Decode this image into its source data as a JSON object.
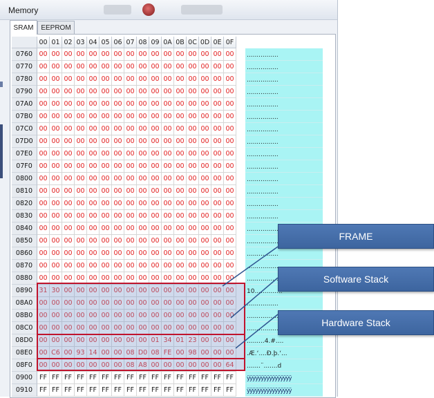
{
  "window": {
    "title": "Memory"
  },
  "tabs": [
    {
      "label": "SRAM",
      "active": true
    },
    {
      "label": "EEPROM",
      "active": false
    }
  ],
  "columns": [
    "00",
    "01",
    "02",
    "03",
    "04",
    "05",
    "06",
    "07",
    "08",
    "09",
    "0A",
    "0B",
    "0C",
    "0D",
    "0E",
    "0F"
  ],
  "rows": [
    {
      "addr": "0760",
      "bytes": [
        "00",
        "00",
        "00",
        "00",
        "00",
        "00",
        "00",
        "00",
        "00",
        "00",
        "00",
        "00",
        "00",
        "00",
        "00",
        "00"
      ],
      "ascii": "................"
    },
    {
      "addr": "0770",
      "bytes": [
        "00",
        "00",
        "00",
        "00",
        "00",
        "00",
        "00",
        "00",
        "00",
        "00",
        "00",
        "00",
        "00",
        "00",
        "00",
        "00"
      ],
      "ascii": "................"
    },
    {
      "addr": "0780",
      "bytes": [
        "00",
        "00",
        "00",
        "00",
        "00",
        "00",
        "00",
        "00",
        "00",
        "00",
        "00",
        "00",
        "00",
        "00",
        "00",
        "00"
      ],
      "ascii": "................"
    },
    {
      "addr": "0790",
      "bytes": [
        "00",
        "00",
        "00",
        "00",
        "00",
        "00",
        "00",
        "00",
        "00",
        "00",
        "00",
        "00",
        "00",
        "00",
        "00",
        "00"
      ],
      "ascii": "................"
    },
    {
      "addr": "07A0",
      "bytes": [
        "00",
        "00",
        "00",
        "00",
        "00",
        "00",
        "00",
        "00",
        "00",
        "00",
        "00",
        "00",
        "00",
        "00",
        "00",
        "00"
      ],
      "ascii": "................"
    },
    {
      "addr": "07B0",
      "bytes": [
        "00",
        "00",
        "00",
        "00",
        "00",
        "00",
        "00",
        "00",
        "00",
        "00",
        "00",
        "00",
        "00",
        "00",
        "00",
        "00"
      ],
      "ascii": "................"
    },
    {
      "addr": "07C0",
      "bytes": [
        "00",
        "00",
        "00",
        "00",
        "00",
        "00",
        "00",
        "00",
        "00",
        "00",
        "00",
        "00",
        "00",
        "00",
        "00",
        "00"
      ],
      "ascii": "................"
    },
    {
      "addr": "07D0",
      "bytes": [
        "00",
        "00",
        "00",
        "00",
        "00",
        "00",
        "00",
        "00",
        "00",
        "00",
        "00",
        "00",
        "00",
        "00",
        "00",
        "00"
      ],
      "ascii": "................"
    },
    {
      "addr": "07E0",
      "bytes": [
        "00",
        "00",
        "00",
        "00",
        "00",
        "00",
        "00",
        "00",
        "00",
        "00",
        "00",
        "00",
        "00",
        "00",
        "00",
        "00"
      ],
      "ascii": "................"
    },
    {
      "addr": "07F0",
      "bytes": [
        "00",
        "00",
        "00",
        "00",
        "00",
        "00",
        "00",
        "00",
        "00",
        "00",
        "00",
        "00",
        "00",
        "00",
        "00",
        "00"
      ],
      "ascii": "................"
    },
    {
      "addr": "0800",
      "bytes": [
        "00",
        "00",
        "00",
        "00",
        "00",
        "00",
        "00",
        "00",
        "00",
        "00",
        "00",
        "00",
        "00",
        "00",
        "00",
        "00"
      ],
      "ascii": "................"
    },
    {
      "addr": "0810",
      "bytes": [
        "00",
        "00",
        "00",
        "00",
        "00",
        "00",
        "00",
        "00",
        "00",
        "00",
        "00",
        "00",
        "00",
        "00",
        "00",
        "00"
      ],
      "ascii": "................"
    },
    {
      "addr": "0820",
      "bytes": [
        "00",
        "00",
        "00",
        "00",
        "00",
        "00",
        "00",
        "00",
        "00",
        "00",
        "00",
        "00",
        "00",
        "00",
        "00",
        "00"
      ],
      "ascii": "................"
    },
    {
      "addr": "0830",
      "bytes": [
        "00",
        "00",
        "00",
        "00",
        "00",
        "00",
        "00",
        "00",
        "00",
        "00",
        "00",
        "00",
        "00",
        "00",
        "00",
        "00"
      ],
      "ascii": "................"
    },
    {
      "addr": "0840",
      "bytes": [
        "00",
        "00",
        "00",
        "00",
        "00",
        "00",
        "00",
        "00",
        "00",
        "00",
        "00",
        "00",
        "00",
        "00",
        "00",
        "00"
      ],
      "ascii": "................"
    },
    {
      "addr": "0850",
      "bytes": [
        "00",
        "00",
        "00",
        "00",
        "00",
        "00",
        "00",
        "00",
        "00",
        "00",
        "00",
        "00",
        "00",
        "00",
        "00",
        "00"
      ],
      "ascii": "................"
    },
    {
      "addr": "0860",
      "bytes": [
        "00",
        "00",
        "00",
        "00",
        "00",
        "00",
        "00",
        "00",
        "00",
        "00",
        "00",
        "00",
        "00",
        "00",
        "00",
        "00"
      ],
      "ascii": "................"
    },
    {
      "addr": "0870",
      "bytes": [
        "00",
        "00",
        "00",
        "00",
        "00",
        "00",
        "00",
        "00",
        "00",
        "00",
        "00",
        "00",
        "00",
        "00",
        "00",
        "00"
      ],
      "ascii": "................"
    },
    {
      "addr": "0880",
      "bytes": [
        "00",
        "00",
        "00",
        "00",
        "00",
        "00",
        "00",
        "00",
        "00",
        "00",
        "00",
        "00",
        "00",
        "00",
        "00",
        "00"
      ],
      "ascii": "................"
    },
    {
      "addr": "0890",
      "bytes": [
        "31",
        "30",
        "00",
        "00",
        "00",
        "00",
        "00",
        "00",
        "00",
        "00",
        "00",
        "00",
        "00",
        "00",
        "00",
        "00"
      ],
      "ascii": "10.............."
    },
    {
      "addr": "08A0",
      "bytes": [
        "00",
        "00",
        "00",
        "00",
        "00",
        "00",
        "00",
        "00",
        "00",
        "00",
        "00",
        "00",
        "00",
        "00",
        "00",
        "00"
      ],
      "ascii": "................"
    },
    {
      "addr": "08B0",
      "bytes": [
        "00",
        "00",
        "00",
        "00",
        "00",
        "00",
        "00",
        "00",
        "00",
        "00",
        "00",
        "00",
        "00",
        "00",
        "00",
        "00"
      ],
      "ascii": "................"
    },
    {
      "addr": "08C0",
      "bytes": [
        "00",
        "00",
        "00",
        "00",
        "00",
        "00",
        "00",
        "00",
        "00",
        "00",
        "00",
        "00",
        "00",
        "00",
        "00",
        "00"
      ],
      "ascii": "................"
    },
    {
      "addr": "08D0",
      "bytes": [
        "00",
        "00",
        "00",
        "00",
        "00",
        "00",
        "00",
        "00",
        "00",
        "01",
        "34",
        "01",
        "23",
        "00",
        "00",
        "00"
      ],
      "ascii": ".........4.#...."
    },
    {
      "addr": "08E0",
      "bytes": [
        "00",
        "C6",
        "00",
        "93",
        "14",
        "00",
        "00",
        "08",
        "D0",
        "08",
        "FE",
        "00",
        "98",
        "00",
        "00",
        "00"
      ],
      "ascii": ".Æ.‘....Ð.þ.‘..."
    },
    {
      "addr": "08F0",
      "bytes": [
        "00",
        "00",
        "00",
        "00",
        "00",
        "00",
        "00",
        "08",
        "A8",
        "00",
        "00",
        "00",
        "00",
        "00",
        "00",
        "64"
      ],
      "ascii": ".......¨.......d"
    },
    {
      "addr": "0900",
      "bytes": [
        "FF",
        "FF",
        "FF",
        "FF",
        "FF",
        "FF",
        "FF",
        "FF",
        "FF",
        "FF",
        "FF",
        "FF",
        "FF",
        "FF",
        "FF",
        "FF"
      ],
      "ascii": "ÿÿÿÿÿÿÿÿÿÿÿÿÿÿÿÿ"
    },
    {
      "addr": "0910",
      "bytes": [
        "FF",
        "FF",
        "FF",
        "FF",
        "FF",
        "FF",
        "FF",
        "FF",
        "FF",
        "FF",
        "FF",
        "FF",
        "FF",
        "FF",
        "FF",
        "FF"
      ],
      "ascii": "ÿÿÿÿÿÿÿÿÿÿÿÿÿÿÿÿ"
    }
  ],
  "callouts": {
    "frame": "FRAME",
    "software_stack": "Software Stack",
    "hardware_stack": "Hardware Stack"
  },
  "colors": {
    "byte_text": "#e22020",
    "ff_text": "#1a1a1a",
    "ascii_bg": "#a9f4f4",
    "highlight_border": "#c0132c",
    "callout_bg": "#4a72ad"
  }
}
